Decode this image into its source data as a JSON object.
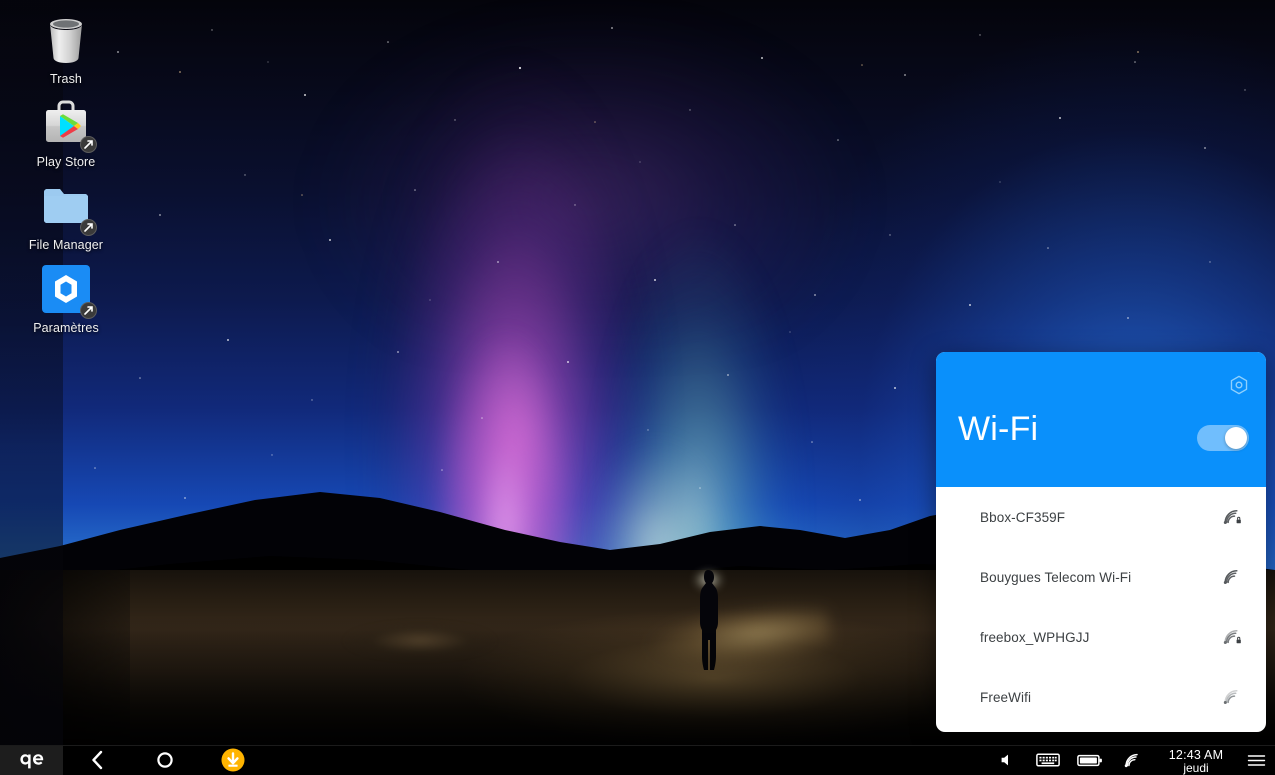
{
  "desktop": {
    "wallpaper_description": "aurora borealis night sky over dark mountains with a person holding a flashlight",
    "icons": [
      {
        "label": "Trash",
        "icon": "trash-can-icon",
        "shortcut": false
      },
      {
        "label": "Play Store",
        "icon": "play-store-icon",
        "shortcut": true
      },
      {
        "label": "File Manager",
        "icon": "folder-icon",
        "shortcut": true
      },
      {
        "label": "Paramètres",
        "icon": "settings-gear-icon",
        "shortcut": true
      }
    ]
  },
  "wifi_panel": {
    "title": "Wi-Fi",
    "header_color": "#0a90fb",
    "settings_icon": "hexagon-gear-icon",
    "toggle": {
      "name": "wifi-toggle",
      "state": "on",
      "state_label": "On"
    },
    "networks": [
      {
        "ssid": "Bbox-CF359F",
        "icon": "wifi-signal-icon",
        "secured": true,
        "strength": 4
      },
      {
        "ssid": "Bouygues Telecom Wi-Fi",
        "icon": "wifi-signal-icon",
        "secured": false,
        "strength": 4
      },
      {
        "ssid": "freebox_WPHGJJ",
        "icon": "wifi-signal-icon",
        "secured": true,
        "strength": 3
      },
      {
        "ssid": "FreeWifi",
        "icon": "wifi-signal-icon",
        "secured": false,
        "strength": 2
      }
    ]
  },
  "taskbar": {
    "logo": {
      "name": "app-launcher-logo",
      "glyph": "ɐe"
    },
    "nav": [
      {
        "name": "back-button",
        "icon": "chevron-left-icon"
      },
      {
        "name": "home-button",
        "icon": "circle-icon"
      },
      {
        "name": "downloads-button",
        "icon": "download-arrow-icon",
        "color": "#ffb400"
      }
    ],
    "tray": [
      {
        "name": "volume-icon",
        "icon": "speaker-icon"
      },
      {
        "name": "keyboard-icon",
        "icon": "keyboard-icon"
      },
      {
        "name": "battery-icon",
        "icon": "battery-full-icon"
      },
      {
        "name": "wifi-status-icon",
        "icon": "wifi-signal-icon"
      }
    ],
    "clock": {
      "time": "12:43 AM",
      "day": "jeudi"
    },
    "menu": {
      "name": "overflow-menu",
      "icon": "hamburger-menu-icon"
    }
  }
}
